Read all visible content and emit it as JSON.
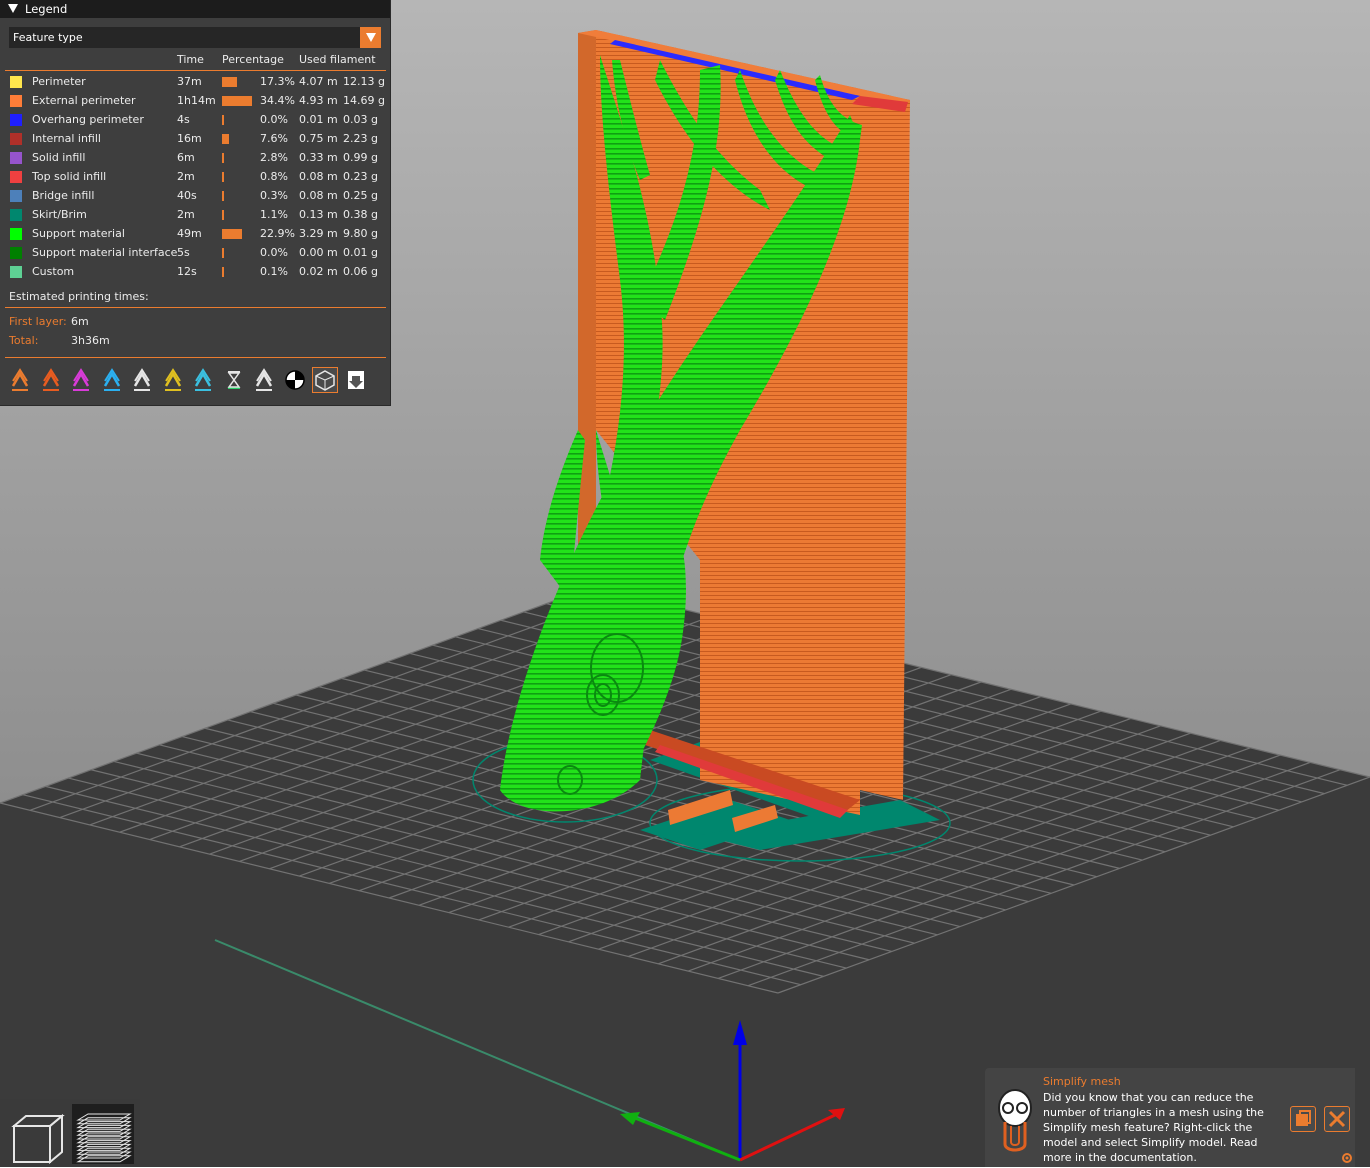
{
  "legend": {
    "title": "Legend",
    "view_type": "Feature type",
    "columns": {
      "time": "Time",
      "percentage": "Percentage",
      "used_filament": "Used filament"
    },
    "rows": [
      {
        "name": "Perimeter",
        "color": "#ffe64d",
        "time": "37m",
        "pct": "17.3%",
        "bar": 0.173,
        "length": "4.07 m",
        "weight": "12.13 g"
      },
      {
        "name": "External perimeter",
        "color": "#ff7d38",
        "time": "1h14m",
        "pct": "34.4%",
        "bar": 0.344,
        "length": "4.93 m",
        "weight": "14.69 g"
      },
      {
        "name": "Overhang perimeter",
        "color": "#1f1fff",
        "time": "4s",
        "pct": "0.0%",
        "bar": 0.0,
        "length": "0.01 m",
        "weight": "0.03 g"
      },
      {
        "name": "Internal infill",
        "color": "#b03029",
        "time": "16m",
        "pct": "7.6%",
        "bar": 0.076,
        "length": "0.75 m",
        "weight": "2.23 g"
      },
      {
        "name": "Solid infill",
        "color": "#9654cc",
        "time": "6m",
        "pct": "2.8%",
        "bar": 0.028,
        "length": "0.33 m",
        "weight": "0.99 g"
      },
      {
        "name": "Top solid infill",
        "color": "#f04040",
        "time": "2m",
        "pct": "0.8%",
        "bar": 0.008,
        "length": "0.08 m",
        "weight": "0.23 g"
      },
      {
        "name": "Bridge infill",
        "color": "#4d80ba",
        "time": "40s",
        "pct": "0.3%",
        "bar": 0.003,
        "length": "0.08 m",
        "weight": "0.25 g"
      },
      {
        "name": "Skirt/Brim",
        "color": "#00876e",
        "time": "2m",
        "pct": "1.1%",
        "bar": 0.011,
        "length": "0.13 m",
        "weight": "0.38 g"
      },
      {
        "name": "Support material",
        "color": "#00ff00",
        "time": "49m",
        "pct": "22.9%",
        "bar": 0.229,
        "length": "3.29 m",
        "weight": "9.80 g"
      },
      {
        "name": "Support material interface",
        "color": "#008000",
        "time": "5s",
        "pct": "0.0%",
        "bar": 0.0,
        "length": "0.00 m",
        "weight": "0.01 g"
      },
      {
        "name": "Custom",
        "color": "#5ed194",
        "time": "12s",
        "pct": "0.1%",
        "bar": 0.001,
        "length": "0.02 m",
        "weight": "0.06 g"
      }
    ],
    "estimated_label": "Estimated printing times:",
    "first_layer_label": "First layer:",
    "first_layer_value": "6m",
    "total_label": "Total:",
    "total_value": "3h36m",
    "toolbar_icons": [
      "travel-icon",
      "wipe-icon",
      "retractions-icon",
      "deretractions-icon",
      "seams-icon",
      "tool-changes-icon",
      "color-changes-icon",
      "pause-icon",
      "custom-gcode-icon",
      "center-of-gravity-icon",
      "shells-icon",
      "tool-marker-icon"
    ]
  },
  "hint": {
    "title": "Simplify mesh",
    "body": "Did you know that you can reduce the number of triangles in a mesh using the Simplify mesh feature? Right-click the model and select Simplify model. Read more in the documentation."
  },
  "colors": {
    "accent": "#eb7c2f",
    "support": "#22e000",
    "perimeter": "#e8742e"
  }
}
